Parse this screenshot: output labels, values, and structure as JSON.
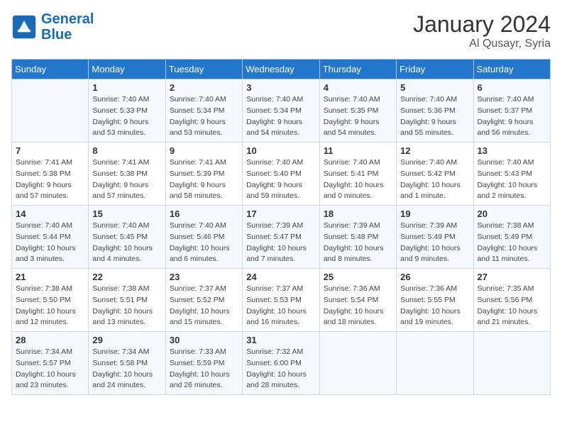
{
  "header": {
    "logo_general": "General",
    "logo_blue": "Blue",
    "title": "January 2024",
    "subtitle": "Al Qusayr, Syria"
  },
  "days_of_week": [
    "Sunday",
    "Monday",
    "Tuesday",
    "Wednesday",
    "Thursday",
    "Friday",
    "Saturday"
  ],
  "weeks": [
    [
      {
        "day": "",
        "sunrise": "",
        "sunset": "",
        "daylight": ""
      },
      {
        "day": "1",
        "sunrise": "Sunrise: 7:40 AM",
        "sunset": "Sunset: 5:33 PM",
        "daylight": "Daylight: 9 hours and 53 minutes."
      },
      {
        "day": "2",
        "sunrise": "Sunrise: 7:40 AM",
        "sunset": "Sunset: 5:34 PM",
        "daylight": "Daylight: 9 hours and 53 minutes."
      },
      {
        "day": "3",
        "sunrise": "Sunrise: 7:40 AM",
        "sunset": "Sunset: 5:34 PM",
        "daylight": "Daylight: 9 hours and 54 minutes."
      },
      {
        "day": "4",
        "sunrise": "Sunrise: 7:40 AM",
        "sunset": "Sunset: 5:35 PM",
        "daylight": "Daylight: 9 hours and 54 minutes."
      },
      {
        "day": "5",
        "sunrise": "Sunrise: 7:40 AM",
        "sunset": "Sunset: 5:36 PM",
        "daylight": "Daylight: 9 hours and 55 minutes."
      },
      {
        "day": "6",
        "sunrise": "Sunrise: 7:40 AM",
        "sunset": "Sunset: 5:37 PM",
        "daylight": "Daylight: 9 hours and 56 minutes."
      }
    ],
    [
      {
        "day": "7",
        "sunrise": "Sunrise: 7:41 AM",
        "sunset": "Sunset: 5:38 PM",
        "daylight": "Daylight: 9 hours and 57 minutes."
      },
      {
        "day": "8",
        "sunrise": "Sunrise: 7:41 AM",
        "sunset": "Sunset: 5:38 PM",
        "daylight": "Daylight: 9 hours and 57 minutes."
      },
      {
        "day": "9",
        "sunrise": "Sunrise: 7:41 AM",
        "sunset": "Sunset: 5:39 PM",
        "daylight": "Daylight: 9 hours and 58 minutes."
      },
      {
        "day": "10",
        "sunrise": "Sunrise: 7:40 AM",
        "sunset": "Sunset: 5:40 PM",
        "daylight": "Daylight: 9 hours and 59 minutes."
      },
      {
        "day": "11",
        "sunrise": "Sunrise: 7:40 AM",
        "sunset": "Sunset: 5:41 PM",
        "daylight": "Daylight: 10 hours and 0 minutes."
      },
      {
        "day": "12",
        "sunrise": "Sunrise: 7:40 AM",
        "sunset": "Sunset: 5:42 PM",
        "daylight": "Daylight: 10 hours and 1 minute."
      },
      {
        "day": "13",
        "sunrise": "Sunrise: 7:40 AM",
        "sunset": "Sunset: 5:43 PM",
        "daylight": "Daylight: 10 hours and 2 minutes."
      }
    ],
    [
      {
        "day": "14",
        "sunrise": "Sunrise: 7:40 AM",
        "sunset": "Sunset: 5:44 PM",
        "daylight": "Daylight: 10 hours and 3 minutes."
      },
      {
        "day": "15",
        "sunrise": "Sunrise: 7:40 AM",
        "sunset": "Sunset: 5:45 PM",
        "daylight": "Daylight: 10 hours and 4 minutes."
      },
      {
        "day": "16",
        "sunrise": "Sunrise: 7:40 AM",
        "sunset": "Sunset: 5:46 PM",
        "daylight": "Daylight: 10 hours and 6 minutes."
      },
      {
        "day": "17",
        "sunrise": "Sunrise: 7:39 AM",
        "sunset": "Sunset: 5:47 PM",
        "daylight": "Daylight: 10 hours and 7 minutes."
      },
      {
        "day": "18",
        "sunrise": "Sunrise: 7:39 AM",
        "sunset": "Sunset: 5:48 PM",
        "daylight": "Daylight: 10 hours and 8 minutes."
      },
      {
        "day": "19",
        "sunrise": "Sunrise: 7:39 AM",
        "sunset": "Sunset: 5:49 PM",
        "daylight": "Daylight: 10 hours and 9 minutes."
      },
      {
        "day": "20",
        "sunrise": "Sunrise: 7:38 AM",
        "sunset": "Sunset: 5:49 PM",
        "daylight": "Daylight: 10 hours and 11 minutes."
      }
    ],
    [
      {
        "day": "21",
        "sunrise": "Sunrise: 7:38 AM",
        "sunset": "Sunset: 5:50 PM",
        "daylight": "Daylight: 10 hours and 12 minutes."
      },
      {
        "day": "22",
        "sunrise": "Sunrise: 7:38 AM",
        "sunset": "Sunset: 5:51 PM",
        "daylight": "Daylight: 10 hours and 13 minutes."
      },
      {
        "day": "23",
        "sunrise": "Sunrise: 7:37 AM",
        "sunset": "Sunset: 5:52 PM",
        "daylight": "Daylight: 10 hours and 15 minutes."
      },
      {
        "day": "24",
        "sunrise": "Sunrise: 7:37 AM",
        "sunset": "Sunset: 5:53 PM",
        "daylight": "Daylight: 10 hours and 16 minutes."
      },
      {
        "day": "25",
        "sunrise": "Sunrise: 7:36 AM",
        "sunset": "Sunset: 5:54 PM",
        "daylight": "Daylight: 10 hours and 18 minutes."
      },
      {
        "day": "26",
        "sunrise": "Sunrise: 7:36 AM",
        "sunset": "Sunset: 5:55 PM",
        "daylight": "Daylight: 10 hours and 19 minutes."
      },
      {
        "day": "27",
        "sunrise": "Sunrise: 7:35 AM",
        "sunset": "Sunset: 5:56 PM",
        "daylight": "Daylight: 10 hours and 21 minutes."
      }
    ],
    [
      {
        "day": "28",
        "sunrise": "Sunrise: 7:34 AM",
        "sunset": "Sunset: 5:57 PM",
        "daylight": "Daylight: 10 hours and 23 minutes."
      },
      {
        "day": "29",
        "sunrise": "Sunrise: 7:34 AM",
        "sunset": "Sunset: 5:58 PM",
        "daylight": "Daylight: 10 hours and 24 minutes."
      },
      {
        "day": "30",
        "sunrise": "Sunrise: 7:33 AM",
        "sunset": "Sunset: 5:59 PM",
        "daylight": "Daylight: 10 hours and 26 minutes."
      },
      {
        "day": "31",
        "sunrise": "Sunrise: 7:32 AM",
        "sunset": "Sunset: 6:00 PM",
        "daylight": "Daylight: 10 hours and 28 minutes."
      },
      {
        "day": "",
        "sunrise": "",
        "sunset": "",
        "daylight": ""
      },
      {
        "day": "",
        "sunrise": "",
        "sunset": "",
        "daylight": ""
      },
      {
        "day": "",
        "sunrise": "",
        "sunset": "",
        "daylight": ""
      }
    ]
  ]
}
